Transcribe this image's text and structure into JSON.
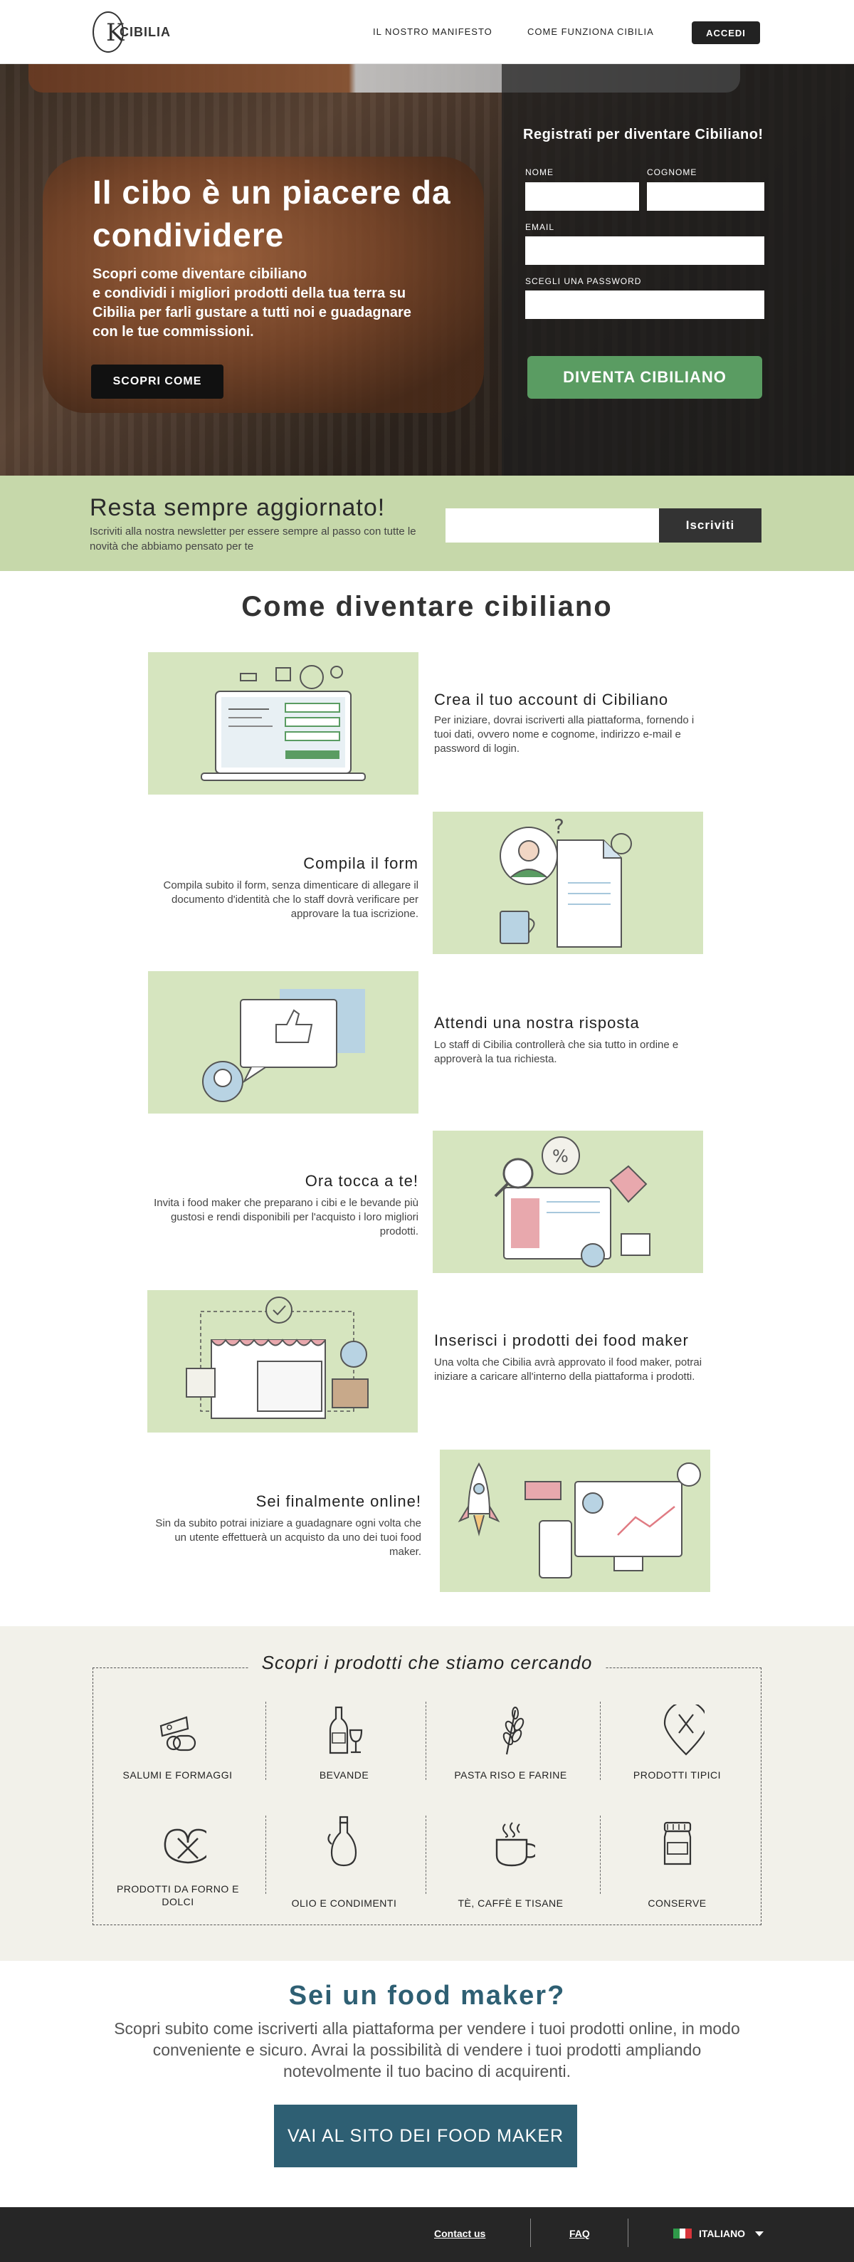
{
  "header": {
    "brand": "CIBILIA",
    "nav": {
      "manifesto": "IL NOSTRO MANIFESTO",
      "how": "COME FUNZIONA CIBILIA"
    },
    "login_label": "ACCEDI"
  },
  "hero": {
    "title": "Il cibo è un piacere da condividere",
    "description_lines": [
      "Scopri come diventare cibiliano",
      "e condividi i migliori prodotti della tua terra su",
      "Cibilia per farli gustare a tutti noi e guadagnare",
      "con le tue commissioni."
    ],
    "cta_label": "SCOPRI COME"
  },
  "register": {
    "title": "Registrati per diventare Cibiliano!",
    "fields": {
      "first_name": "NOME",
      "last_name": "COGNOME",
      "email": "EMAIL",
      "password": "SCEGLI UNA PASSWORD"
    },
    "submit_label": "DIVENTA CIBILIANO"
  },
  "newsletter": {
    "title": "Resta sempre aggiornato!",
    "description": "Iscriviti alla nostra newsletter per essere sempre al passo con tutte le novità che abbiamo pensato per te",
    "button_label": "Iscriviti"
  },
  "how": {
    "title": "Come diventare cibiliano",
    "steps": [
      {
        "title": "Crea il tuo account di Cibiliano",
        "description": "Per iniziare, dovrai iscriverti alla piattaforma, fornendo i tuoi dati, ovvero nome e cognome, indirizzo e-mail e password di login."
      },
      {
        "title": "Compila il form",
        "description": "Compila subito il form, senza dimenticare di allegare il documento d'identità che lo staff dovrà verificare per approvare la tua iscrizione."
      },
      {
        "title": "Attendi una nostra risposta",
        "description": "Lo staff di Cibilia controllerà che sia tutto in ordine e approverà la tua richiesta."
      },
      {
        "title": "Ora tocca a te!",
        "description": "Invita i food maker che preparano i cibi e le bevande più gustosi e rendi disponibili per l'acquisto i loro migliori prodotti."
      },
      {
        "title": "Inserisci i prodotti dei food maker",
        "description": "Una volta che Cibilia avrà approvato il food maker, potrai iniziare a caricare all'interno della piattaforma i prodotti."
      },
      {
        "title": "Sei finalmente online!",
        "description": "Sin da subito potrai iniziare a guadagnare ogni volta che un utente effettuerà un acquisto da uno dei tuoi food maker."
      }
    ]
  },
  "categories": {
    "title": "Scopri i prodotti che stiamo cercando",
    "items": [
      {
        "label": "SALUMI E FORMAGGI",
        "icon": "cheese-salami-icon"
      },
      {
        "label": "BEVANDE",
        "icon": "bottle-glass-icon"
      },
      {
        "label": "PASTA RISO E FARINE",
        "icon": "wheat-icon"
      },
      {
        "label": "PRODOTTI TIPICI",
        "icon": "location-pin-cutlery-icon"
      },
      {
        "label": "PRODOTTI DA FORNO E DOLCI",
        "icon": "pretzel-icon"
      },
      {
        "label": "OLIO E CONDIMENTI",
        "icon": "oil-bottle-icon"
      },
      {
        "label": "TÈ, CAFFÈ E TISANE",
        "icon": "cup-icon"
      },
      {
        "label": "CONSERVE",
        "icon": "jar-icon"
      }
    ]
  },
  "food_maker": {
    "title": "Sei un food maker?",
    "description": "Scopri subito come iscriverti alla piattaforma per vendere i tuoi prodotti online, in modo conveniente e sicuro. Avrai la possibilità di vendere i tuoi prodotti ampliando notevolmente il tuo bacino di acquirenti.",
    "cta_label": "VAI AL SITO DEI FOOD MAKER"
  },
  "footer": {
    "contact": "Contact us",
    "faq": "FAQ",
    "language": "ITALIANO"
  },
  "colors": {
    "green_light": "#c6d8aa",
    "green_button": "#5a9c62",
    "teal": "#2e5f73",
    "dark": "#262626"
  }
}
